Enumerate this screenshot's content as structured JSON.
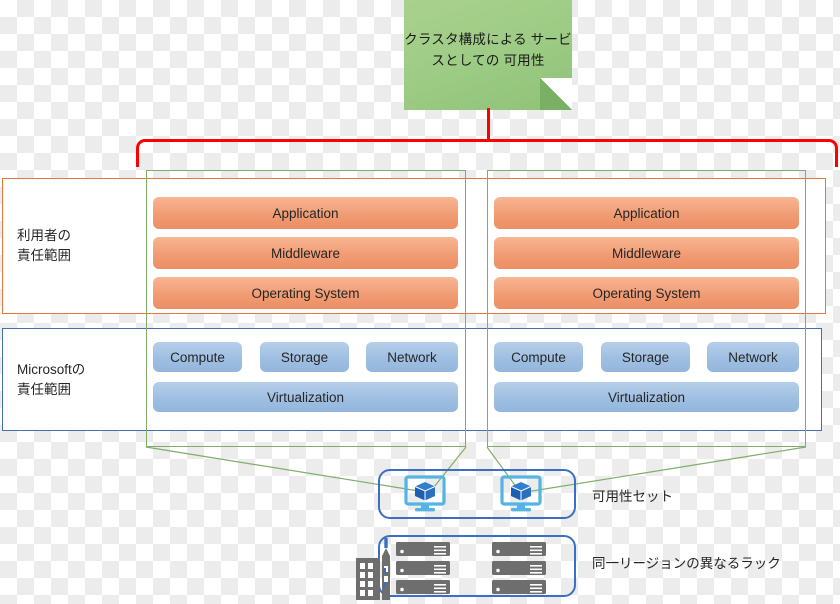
{
  "note": {
    "text": "クラスタ構成による\nサービスとしての\n可用性",
    "fill": "#a9d18e"
  },
  "bracket": {
    "color": "#ff0000"
  },
  "responsibility": {
    "user": {
      "label": "利用者の\n責任範囲",
      "border_color": "#e2793b"
    },
    "microsoft": {
      "label": "Microsoftの\n責任範囲",
      "border_color": "#4472a8"
    }
  },
  "vm_groups": [
    {
      "name": "vm-left",
      "user_layers": [
        "Application",
        "Middleware",
        "Operating System"
      ],
      "platform_row": [
        "Compute",
        "Storage",
        "Network"
      ],
      "platform_base": "Virtualization"
    },
    {
      "name": "vm-right",
      "user_layers": [
        "Application",
        "Middleware",
        "Operating System"
      ],
      "platform_row": [
        "Compute",
        "Storage",
        "Network"
      ],
      "platform_base": "Virtualization"
    }
  ],
  "bottom": {
    "availability_set": {
      "label": "可用性セット",
      "icons": [
        "virtual-machine-icon",
        "virtual-machine-icon"
      ],
      "border_color": "#3b6fc4"
    },
    "racks": {
      "label": "同一リージョンの異なるラック",
      "icons": [
        "server-rack-icon",
        "server-rack-icon"
      ],
      "side_icon": "datacenter-building-icon",
      "border_color": "#3b6fc4"
    }
  },
  "colors": {
    "orange_bar": "#f09a72",
    "blue_bar": "#9dbee1",
    "green_frame": "#7fae6a",
    "red": "#ff0000",
    "blue_outline": "#3b6fc4"
  }
}
